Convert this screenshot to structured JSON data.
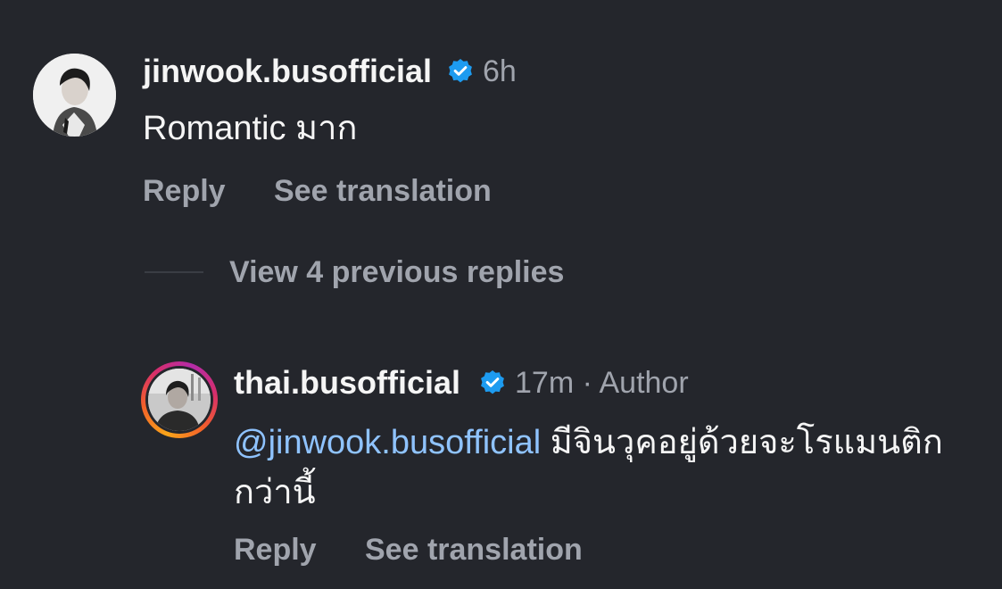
{
  "comment": {
    "username": "jinwook.busofficial",
    "time": "6h",
    "text": "Romantic มาก",
    "actions": {
      "reply": "Reply",
      "see_translation": "See translation"
    }
  },
  "view_replies": "View 4 previous replies",
  "reply": {
    "username": "thai.busofficial",
    "time_author": "17m · Author",
    "mention": "@jinwook.busofficial",
    "text": " มีจินวุคอยู่ด้วยจะโรแมนติกกว่านี้",
    "actions": {
      "reply": "Reply",
      "see_translation": "See translation"
    }
  },
  "colors": {
    "background": "#24262c",
    "primary_text": "#f5f5f5",
    "secondary_text": "#a0a4ad",
    "mention": "#8fc3ff",
    "verified_badge": "#1d9bf0"
  },
  "icons": {
    "verified": "verified-badge-icon"
  }
}
